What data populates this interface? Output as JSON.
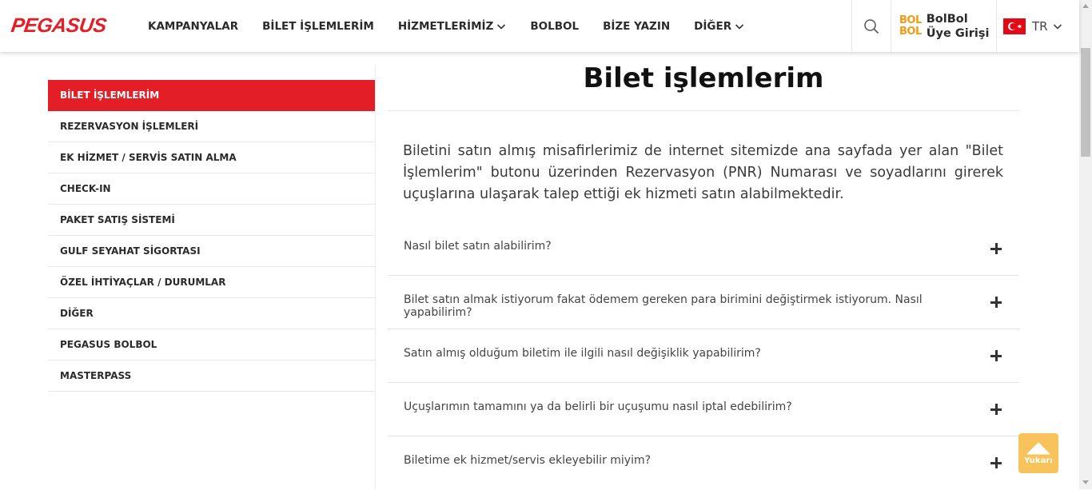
{
  "header": {
    "logo": "PEGASUS",
    "nav": [
      {
        "label": "KAMPANYALAR",
        "dropdown": false
      },
      {
        "label": "BİLET İŞLEMLERİM",
        "dropdown": false
      },
      {
        "label": "HİZMETLERİMİZ",
        "dropdown": true
      },
      {
        "label": "BOLBOL",
        "dropdown": false
      },
      {
        "label": "BİZE YAZIN",
        "dropdown": false
      },
      {
        "label": "DİĞER",
        "dropdown": true
      }
    ],
    "search_icon": "search-icon",
    "bolbol": {
      "mark_top": "BOL",
      "mark_bottom": "BOL",
      "line1": "BolBol",
      "line2": "Üye Girişi"
    },
    "language": {
      "code": "TR",
      "flag": "turkey-flag-icon"
    }
  },
  "sidebar": {
    "items": [
      {
        "label": "BİLET İŞLEMLERİM",
        "active": true
      },
      {
        "label": "REZERVASYON İŞLEMLERİ",
        "active": false
      },
      {
        "label": "EK HİZMET / SERVİS SATIN ALMA",
        "active": false
      },
      {
        "label": "CHECK-IN",
        "active": false
      },
      {
        "label": "PAKET SATIŞ SİSTEMİ",
        "active": false
      },
      {
        "label": "GULF SEYAHAT SİGORTASI",
        "active": false
      },
      {
        "label": "ÖZEL İHTİYAÇLAR / DURUMLAR",
        "active": false
      },
      {
        "label": "DİĞER",
        "active": false
      },
      {
        "label": "PEGASUS BOLBOL",
        "active": false
      },
      {
        "label": "MASTERPASS",
        "active": false
      }
    ]
  },
  "main": {
    "title": "Bilet işlemlerim",
    "intro": "Biletini satın almış misafirlerimiz de internet sitemizde ana sayfada yer alan \"Bilet İşlemlerim\" butonu üzerinden Rezervasyon (PNR) Numarası ve soyadlarını girerek uçuşlarına ulaşarak talep ettiği ek hizmeti satın alabilmektedir.",
    "faq": [
      "Nasıl bilet satın alabilirim?",
      "Bilet satın almak istiyorum fakat ödemem gereken para birimini değiştirmek istiyorum. Nasıl yapabilirim?",
      "Satın almış olduğum biletim ile ilgili nasıl değişiklik yapabilirim?",
      "Uçuşlarımın tamamını ya da belirli bir uçuşumu nasıl iptal edebilirim?",
      "Biletime ek hizmet/servis ekleyebilir miyim?"
    ]
  },
  "back_to_top": {
    "label": "Yukarı"
  },
  "colors": {
    "brand_red": "#e41e26",
    "bolbol_orange": "#f39a12",
    "to_top_yellow": "#f7c35a"
  }
}
